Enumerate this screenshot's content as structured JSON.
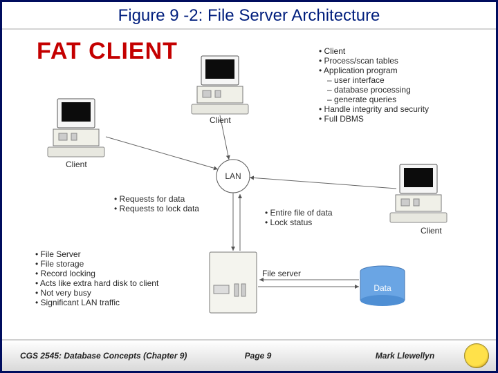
{
  "title": "Figure 9 -2: File Server Architecture",
  "fat_client": "FAT CLIENT",
  "lan": "LAN",
  "labels": {
    "client_left": "Client",
    "client_top": "Client",
    "client_right": "Client",
    "file_server": "File server",
    "data": "Data"
  },
  "client_block": {
    "heading": "Client",
    "items": [
      "Process/scan tables",
      "Application program",
      "user interface",
      "database processing",
      "generate queries",
      "Handle integrity and security",
      "Full DBMS"
    ],
    "subflags": [
      false,
      false,
      true,
      true,
      true,
      false,
      false
    ]
  },
  "mid_block": {
    "left": [
      "Requests for data",
      "Requests to lock data"
    ],
    "right": [
      "Entire file of data",
      "Lock status"
    ]
  },
  "fs_block": {
    "heading": "File Server",
    "items": [
      "File storage",
      "Record locking",
      "Acts like extra hard disk to client",
      "Not very busy",
      "Significant LAN traffic"
    ]
  },
  "footer": {
    "left": "CGS 2545: Database Concepts  (Chapter 9)",
    "center": "Page 9",
    "right": "Mark Llewellyn"
  }
}
